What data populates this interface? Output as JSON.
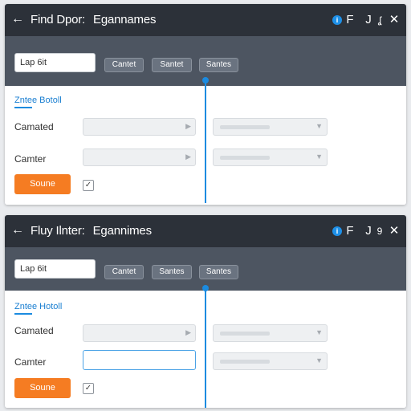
{
  "windows": [
    {
      "title_left": "Find Dpor:",
      "title_right": "Egannames",
      "back_icon": "←",
      "controls": {
        "info": "i",
        "f": "F",
        "j": "J",
        "s": "ʆ",
        "close": "✕"
      },
      "search_value": "Lap 6it",
      "buttons": [
        "Cantet",
        "Santet",
        "Santes"
      ],
      "section": "Zntee Botoll",
      "row1_label": "Camated",
      "row2_label": "Camter",
      "action_label": "Soune",
      "check_mark": "✓"
    },
    {
      "title_left": "Fluy Ilnter:",
      "title_right": "Egannimes",
      "back_icon": "←",
      "controls": {
        "info": "i",
        "f": "F",
        "j": "J",
        "s": "9",
        "close": "✕"
      },
      "search_value": "Lap 6it",
      "buttons": [
        "Cantet",
        "Santes",
        "Santes"
      ],
      "section": "Zntee Hotoll",
      "row1_label": "Camated",
      "row2_label": "Camter",
      "action_label": "Soune",
      "check_mark": "✓"
    }
  ],
  "colors": {
    "titlebar": "#2c3139",
    "toolbar": "#4d5561",
    "accent": "#1b8be0",
    "action": "#f57c22"
  }
}
